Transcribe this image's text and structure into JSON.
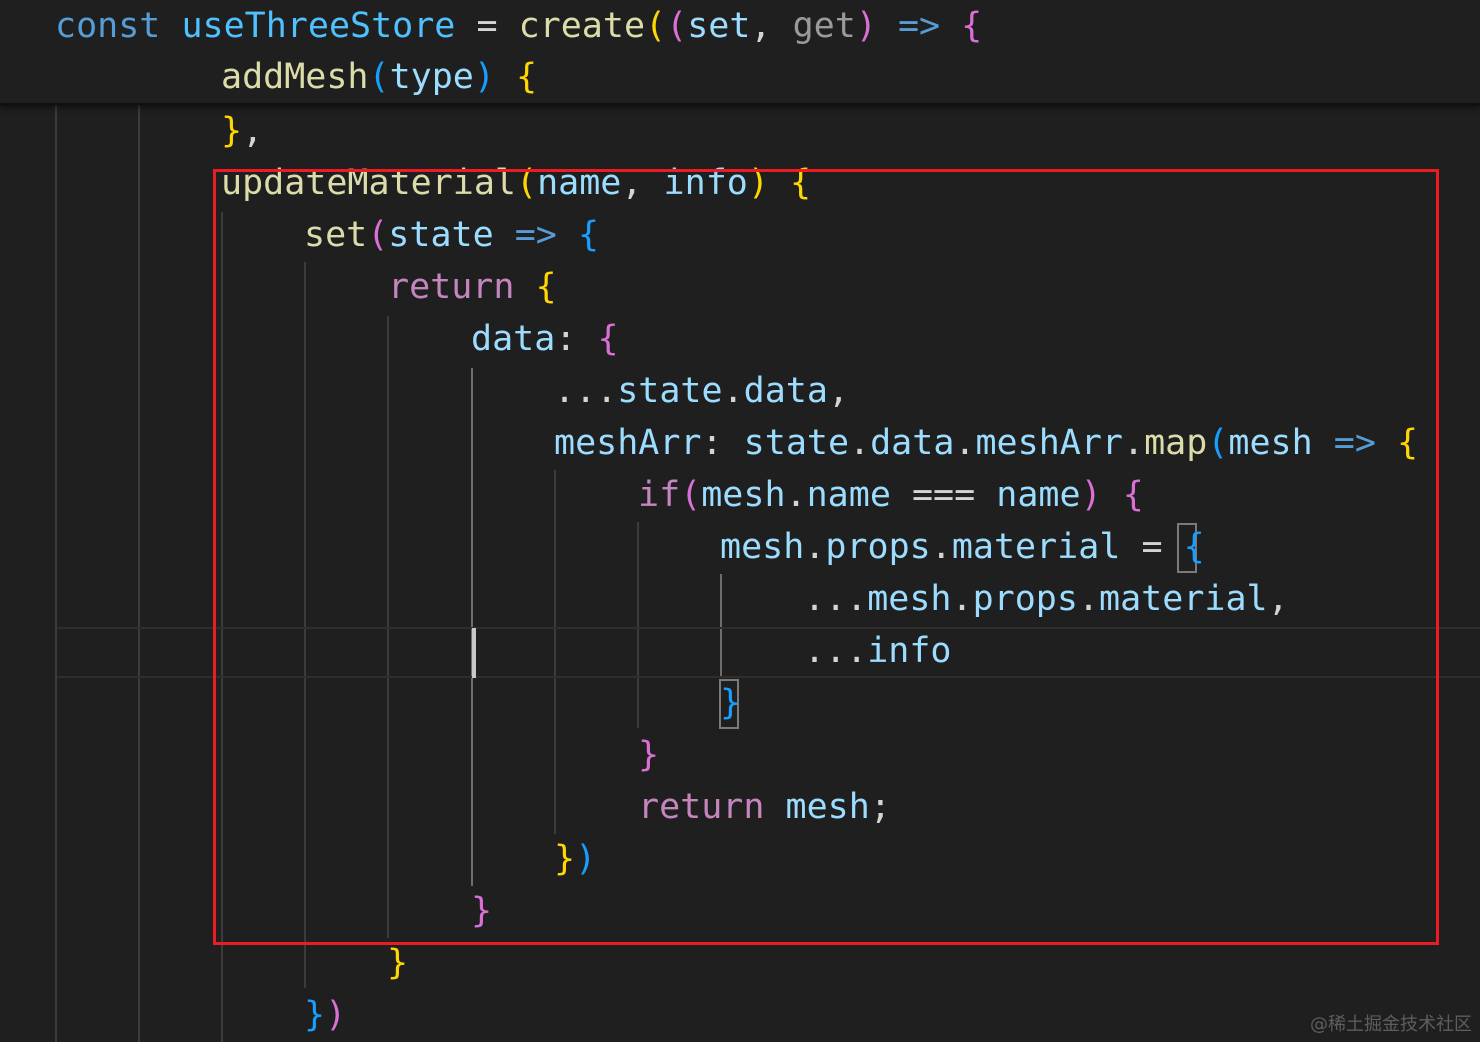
{
  "colors": {
    "background": "#1f1f1f",
    "keyword_storage": "#569cd6",
    "keyword_control": "#c586c0",
    "function": "#dcdcaa",
    "variable": "#9cdcfe",
    "constant": "#4fc1ff",
    "plain": "#d4d4d4",
    "bracket_gold": "#ffd700",
    "bracket_pink": "#da70d6",
    "bracket_blue": "#179fff",
    "highlight_border": "#ec1c24",
    "watermark": "#5e5e5e"
  },
  "code_lines": [
    {
      "sticky": true,
      "tokens": [
        {
          "text": "const ",
          "color": "#569cd6"
        },
        {
          "text": "useThreeStore",
          "color": "#4fc1ff"
        },
        {
          "text": " = ",
          "color": "#d4d4d4"
        },
        {
          "text": "create",
          "color": "#dcdcaa"
        },
        {
          "text": "(",
          "color": "#ffd700"
        },
        {
          "text": "(",
          "color": "#da70d6"
        },
        {
          "text": "set",
          "color": "#9cdcfe"
        },
        {
          "text": ", ",
          "color": "#d4d4d4"
        },
        {
          "text": "get",
          "color": "#9a9a9a"
        },
        {
          "text": ") ",
          "color": "#da70d6"
        },
        {
          "text": "=> ",
          "color": "#569cd6"
        },
        {
          "text": "{",
          "color": "#da70d6"
        }
      ]
    },
    {
      "sticky": true,
      "tokens": [
        {
          "text": "addMesh",
          "color": "#dcdcaa"
        },
        {
          "text": "(",
          "color": "#179fff"
        },
        {
          "text": "type",
          "color": "#9cdcfe"
        },
        {
          "text": ") ",
          "color": "#179fff"
        },
        {
          "text": "{",
          "color": "#ffd700"
        }
      ]
    },
    {
      "tokens": [
        {
          "text": "}",
          "color": "#ffd700"
        },
        {
          "text": ",",
          "color": "#d4d4d4"
        }
      ]
    },
    {
      "tokens": [
        {
          "text": "updateMaterial",
          "color": "#dcdcaa"
        },
        {
          "text": "(",
          "color": "#ffd700"
        },
        {
          "text": "name",
          "color": "#9cdcfe"
        },
        {
          "text": ", ",
          "color": "#d4d4d4"
        },
        {
          "text": "info",
          "color": "#9cdcfe"
        },
        {
          "text": ") ",
          "color": "#ffd700"
        },
        {
          "text": "{",
          "color": "#ffd700"
        }
      ]
    },
    {
      "tokens": [
        {
          "text": "set",
          "color": "#dcdcaa"
        },
        {
          "text": "(",
          "color": "#da70d6"
        },
        {
          "text": "state",
          "color": "#9cdcfe"
        },
        {
          "text": " => ",
          "color": "#569cd6"
        },
        {
          "text": "{",
          "color": "#179fff"
        }
      ]
    },
    {
      "tokens": [
        {
          "text": "return ",
          "color": "#c586c0"
        },
        {
          "text": "{",
          "color": "#ffd700"
        }
      ]
    },
    {
      "tokens": [
        {
          "text": "data",
          "color": "#9cdcfe"
        },
        {
          "text": ": ",
          "color": "#d4d4d4"
        },
        {
          "text": "{",
          "color": "#da70d6"
        }
      ]
    },
    {
      "tokens": [
        {
          "text": "...",
          "color": "#d4d4d4"
        },
        {
          "text": "state",
          "color": "#9cdcfe"
        },
        {
          "text": ".",
          "color": "#d4d4d4"
        },
        {
          "text": "data",
          "color": "#9cdcfe"
        },
        {
          "text": ",",
          "color": "#d4d4d4"
        }
      ]
    },
    {
      "tokens": [
        {
          "text": "meshArr",
          "color": "#9cdcfe"
        },
        {
          "text": ": ",
          "color": "#d4d4d4"
        },
        {
          "text": "state",
          "color": "#9cdcfe"
        },
        {
          "text": ".",
          "color": "#d4d4d4"
        },
        {
          "text": "data",
          "color": "#9cdcfe"
        },
        {
          "text": ".",
          "color": "#d4d4d4"
        },
        {
          "text": "meshArr",
          "color": "#9cdcfe"
        },
        {
          "text": ".",
          "color": "#d4d4d4"
        },
        {
          "text": "map",
          "color": "#dcdcaa"
        },
        {
          "text": "(",
          "color": "#179fff"
        },
        {
          "text": "mesh",
          "color": "#9cdcfe"
        },
        {
          "text": " => ",
          "color": "#569cd6"
        },
        {
          "text": "{",
          "color": "#ffd700"
        }
      ]
    },
    {
      "tokens": [
        {
          "text": "if",
          "color": "#c586c0"
        },
        {
          "text": "(",
          "color": "#da70d6"
        },
        {
          "text": "mesh",
          "color": "#9cdcfe"
        },
        {
          "text": ".",
          "color": "#d4d4d4"
        },
        {
          "text": "name",
          "color": "#9cdcfe"
        },
        {
          "text": " === ",
          "color": "#d4d4d4"
        },
        {
          "text": "name",
          "color": "#9cdcfe"
        },
        {
          "text": ") ",
          "color": "#da70d6"
        },
        {
          "text": "{",
          "color": "#da70d6"
        }
      ]
    },
    {
      "tokens": [
        {
          "text": "mesh",
          "color": "#9cdcfe"
        },
        {
          "text": ".",
          "color": "#d4d4d4"
        },
        {
          "text": "props",
          "color": "#9cdcfe"
        },
        {
          "text": ".",
          "color": "#d4d4d4"
        },
        {
          "text": "material",
          "color": "#9cdcfe"
        },
        {
          "text": " = ",
          "color": "#d4d4d4"
        },
        {
          "text": "{",
          "color": "#179fff"
        }
      ]
    },
    {
      "tokens": [
        {
          "text": "...",
          "color": "#d4d4d4"
        },
        {
          "text": "mesh",
          "color": "#9cdcfe"
        },
        {
          "text": ".",
          "color": "#d4d4d4"
        },
        {
          "text": "props",
          "color": "#9cdcfe"
        },
        {
          "text": ".",
          "color": "#d4d4d4"
        },
        {
          "text": "material",
          "color": "#9cdcfe"
        },
        {
          "text": ",",
          "color": "#d4d4d4"
        }
      ]
    },
    {
      "tokens": [
        {
          "text": "...",
          "color": "#d4d4d4"
        },
        {
          "text": "info",
          "color": "#9cdcfe"
        }
      ]
    },
    {
      "tokens": [
        {
          "text": "}",
          "color": "#179fff"
        }
      ]
    },
    {
      "tokens": [
        {
          "text": "}",
          "color": "#da70d6"
        }
      ]
    },
    {
      "tokens": [
        {
          "text": "return ",
          "color": "#c586c0"
        },
        {
          "text": "mesh",
          "color": "#9cdcfe"
        },
        {
          "text": ";",
          "color": "#d4d4d4"
        }
      ]
    },
    {
      "tokens": [
        {
          "text": "}",
          "color": "#ffd700"
        },
        {
          "text": ")",
          "color": "#179fff"
        }
      ]
    },
    {
      "tokens": [
        {
          "text": "}",
          "color": "#da70d6"
        }
      ]
    },
    {
      "tokens": [
        {
          "text": "}",
          "color": "#ffd700"
        }
      ]
    },
    {
      "tokens": [
        {
          "text": "}",
          "color": "#179fff"
        },
        {
          "text": ")",
          "color": "#da70d6"
        }
      ]
    }
  ],
  "watermark": "@稀土掘金技术社区"
}
